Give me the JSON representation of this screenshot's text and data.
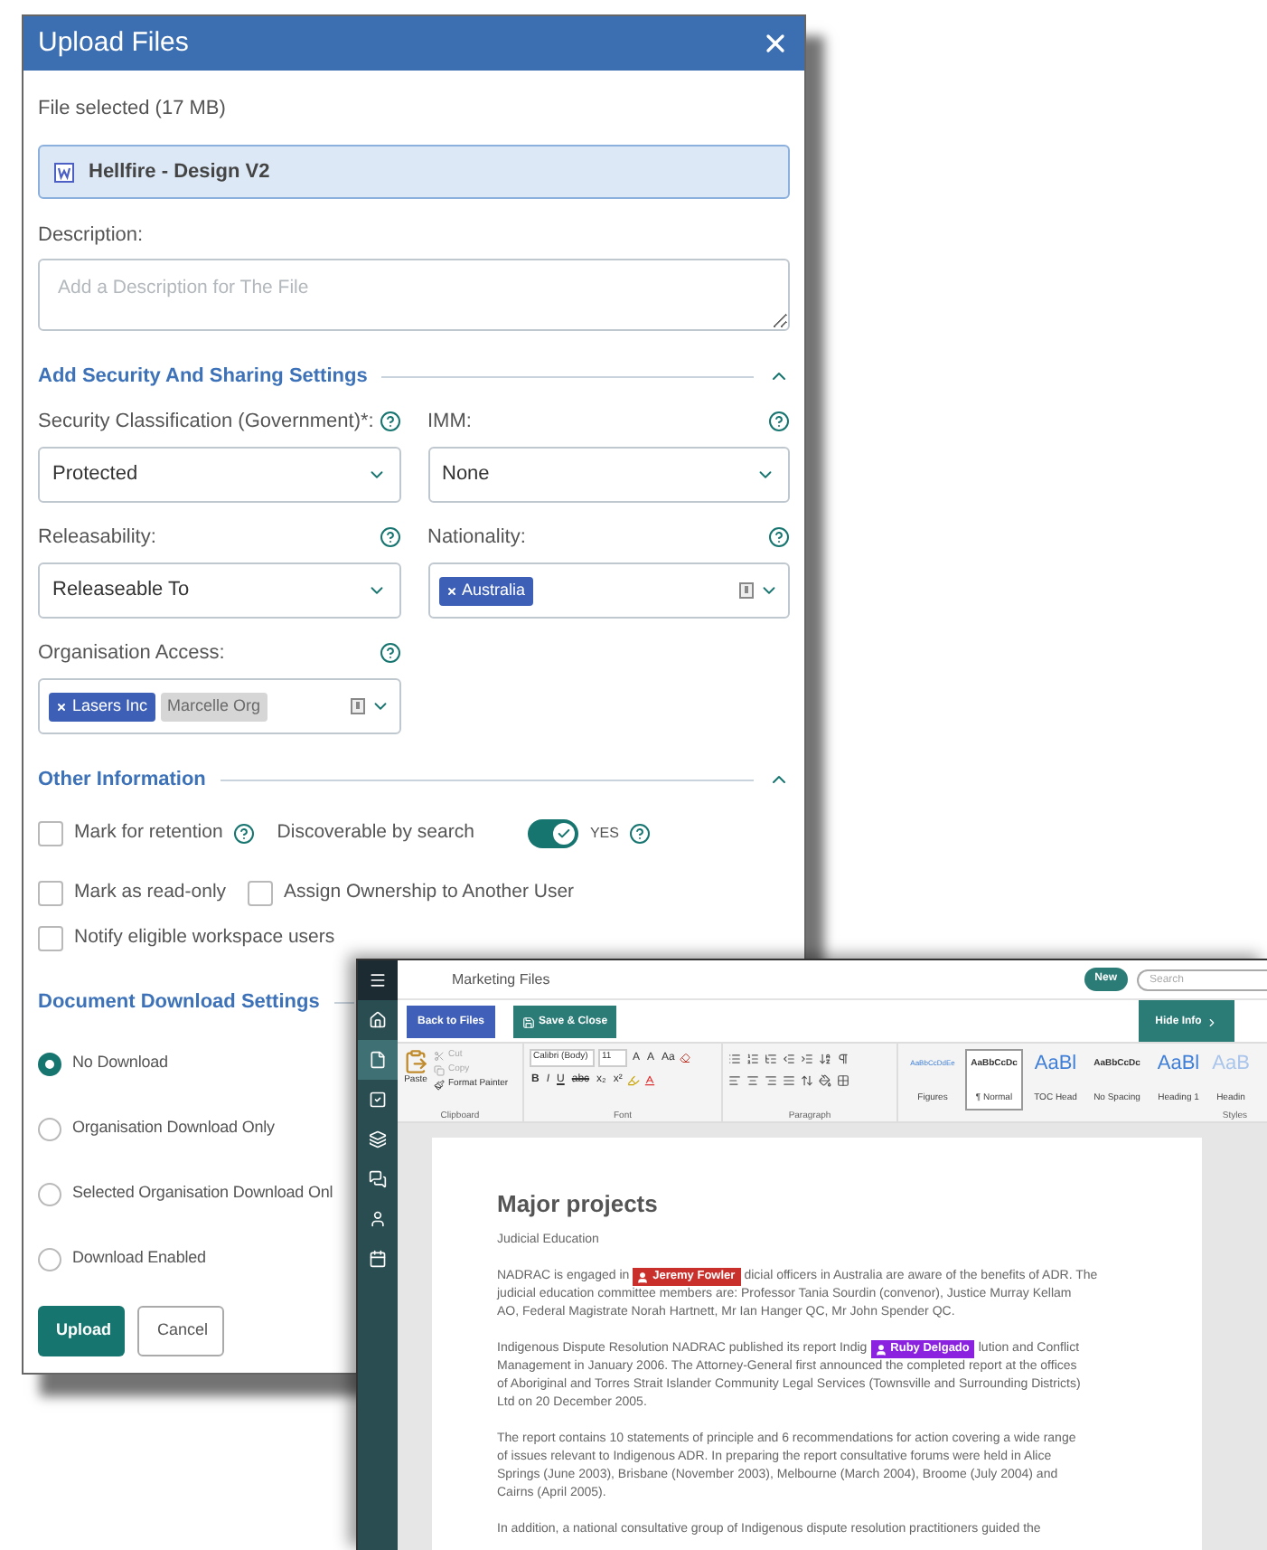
{
  "dialog": {
    "title": "Upload Files",
    "file_label": "File selected (17 MB)",
    "file_name": "Hellfire - Design V2",
    "description_label": "Description:",
    "description_placeholder": "Add a Description for The File",
    "security": {
      "title": "Add Security And Sharing Settings",
      "expanded": true,
      "fields": [
        {
          "label": "Security Classification (Government)*:",
          "kind": "select",
          "value": "Protected"
        },
        {
          "label": "IMM:",
          "kind": "select",
          "value": "None"
        },
        {
          "label": "Releasability:",
          "kind": "select",
          "value": "Releaseable To"
        },
        {
          "label": "Nationality:",
          "kind": "multi",
          "chips": [
            {
              "label": "Australia",
              "disabled": false
            }
          ]
        },
        {
          "label": "Organisation Access:",
          "kind": "multi",
          "chips": [
            {
              "label": "Lasers Inc",
              "disabled": false
            },
            {
              "label": "Marcelle Org",
              "disabled": true
            }
          ]
        }
      ]
    },
    "other": {
      "title": "Other Information",
      "expanded": true,
      "rows": [
        [
          {
            "kind": "checkbox",
            "label": "Mark for retention",
            "checked": false,
            "help": true
          },
          {
            "kind": "toggle",
            "label": "Discoverable by search",
            "on": true,
            "state_label": "YES",
            "help": true
          }
        ],
        [
          {
            "kind": "checkbox",
            "label": "Mark as read-only",
            "checked": false,
            "help": false
          },
          {
            "kind": "checkbox",
            "label": "Assign Ownership to Another User",
            "checked": false,
            "help": false
          }
        ],
        [
          {
            "kind": "checkbox",
            "label": "Notify eligible workspace users",
            "checked": false,
            "help": false
          }
        ]
      ]
    },
    "download": {
      "title": "Document Download Settings",
      "options": [
        {
          "label": "No Download",
          "selected": true
        },
        {
          "label": "Organisation Download Only",
          "selected": false
        },
        {
          "label": "Selected Organisation Download Onl",
          "selected": false
        },
        {
          "label": "Download Enabled",
          "selected": false
        }
      ]
    },
    "buttons": [
      {
        "label": "Upload",
        "kind": "primary"
      },
      {
        "label": "Cancel",
        "kind": "secondary"
      }
    ]
  },
  "editor": {
    "title": "Marketing Files",
    "new_button": "New",
    "search_placeholder": "Search",
    "sidebar": [
      {
        "kind": "menu",
        "selected": false
      },
      {
        "kind": "home",
        "selected": false
      },
      {
        "kind": "file",
        "selected": true
      },
      {
        "kind": "tasks",
        "selected": false
      },
      {
        "kind": "layers",
        "selected": false
      },
      {
        "kind": "chat",
        "selected": false
      },
      {
        "kind": "user",
        "selected": false
      },
      {
        "kind": "calendar",
        "selected": false
      }
    ],
    "back_button": "Back to Files",
    "save_button": "Save & Close",
    "hide_button": "Hide Info",
    "ribbon": {
      "clipboard": {
        "label": "Clipboard",
        "paste": "Paste",
        "items": [
          {
            "kind": "cut",
            "label": "Cut",
            "disabled": true
          },
          {
            "kind": "copy",
            "label": "Copy",
            "disabled": true
          },
          {
            "kind": "painter",
            "label": "Format Painter",
            "disabled": false
          }
        ]
      },
      "font": {
        "label": "Font",
        "font_name": "Calibri (Body)",
        "font_size": "11",
        "row1": [
          "A",
          "A",
          "Aa"
        ],
        "row2": [
          "B",
          "I",
          "U",
          "abc",
          "x₂",
          "x²"
        ]
      },
      "paragraph": {
        "label": "Paragraph"
      },
      "styles": {
        "label": "Styles",
        "items": [
          {
            "preview": "AaBbCcDdEe",
            "name": "Figures",
            "kind": "small",
            "selected": false
          },
          {
            "preview": "AaBbCcDc",
            "name": "¶ Normal",
            "kind": "normal",
            "selected": true
          },
          {
            "preview": "AaBl",
            "name": "TOC Head",
            "kind": "large",
            "selected": false
          },
          {
            "preview": "AaBbCcDc",
            "name": "No Spacing",
            "kind": "normal",
            "selected": false
          },
          {
            "preview": "AaBl",
            "name": "Heading 1",
            "kind": "large",
            "selected": false
          },
          {
            "preview": "AaB",
            "name": "Headin",
            "kind": "faded",
            "selected": false
          }
        ]
      }
    },
    "document": {
      "heading": "Major projects",
      "subheading": "Judicial Education",
      "paragraphs": [
        [
          [
            {
              "kind": "text",
              "text": "NADRAC is engaged in"
            },
            {
              "kind": "cursor",
              "text": "Jeremy Fowler",
              "color": "#c9302c"
            },
            {
              "kind": "text",
              "text": "dicial officers in Australia are aware of the benefits of ADR. The"
            }
          ],
          [
            {
              "kind": "text",
              "text": "judicial education committee members are: Professor Tania Sourdin (convenor), Justice Murray Kellam"
            }
          ],
          [
            {
              "kind": "text",
              "text": "AO, Federal Magistrate Norah Hartnett, Mr Ian Hanger QC, Mr John Spender QC."
            }
          ]
        ],
        [
          [
            {
              "kind": "text",
              "text": "Indigenous Dispute Resolution NADRAC published its report Indig"
            },
            {
              "kind": "cursor",
              "text": "Ruby Delgado",
              "color": "#8a22e0"
            },
            {
              "kind": "text",
              "text": "lution and Conflict"
            }
          ],
          [
            {
              "kind": "text",
              "text": "Management in January 2006. The Attorney-General first announced the completed report at the offices"
            }
          ],
          [
            {
              "kind": "text",
              "text": "of Aboriginal and Torres Strait Islander Community Legal Services (Townsville and Surrounding Districts)"
            }
          ],
          [
            {
              "kind": "text",
              "text": "Ltd on 20 December 2005."
            }
          ]
        ],
        [
          [
            {
              "kind": "text",
              "text": "The report contains 10 statements of principle and 6 recommendations for action covering a wide range"
            }
          ],
          [
            {
              "kind": "text",
              "text": "of issues relevant to Indigenous ADR. In preparing the report consultative forums were held in Alice"
            }
          ],
          [
            {
              "kind": "text",
              "text": "Springs (June 2003), Brisbane (November 2003), Melbourne (March 2004), Broome (July 2004) and"
            }
          ],
          [
            {
              "kind": "text",
              "text": "Cairns (April 2005)."
            }
          ]
        ],
        [
          [
            {
              "kind": "text",
              "text": "In addition, a national consultative group of Indigenous dispute resolution practitioners guided the"
            }
          ]
        ]
      ]
    }
  }
}
